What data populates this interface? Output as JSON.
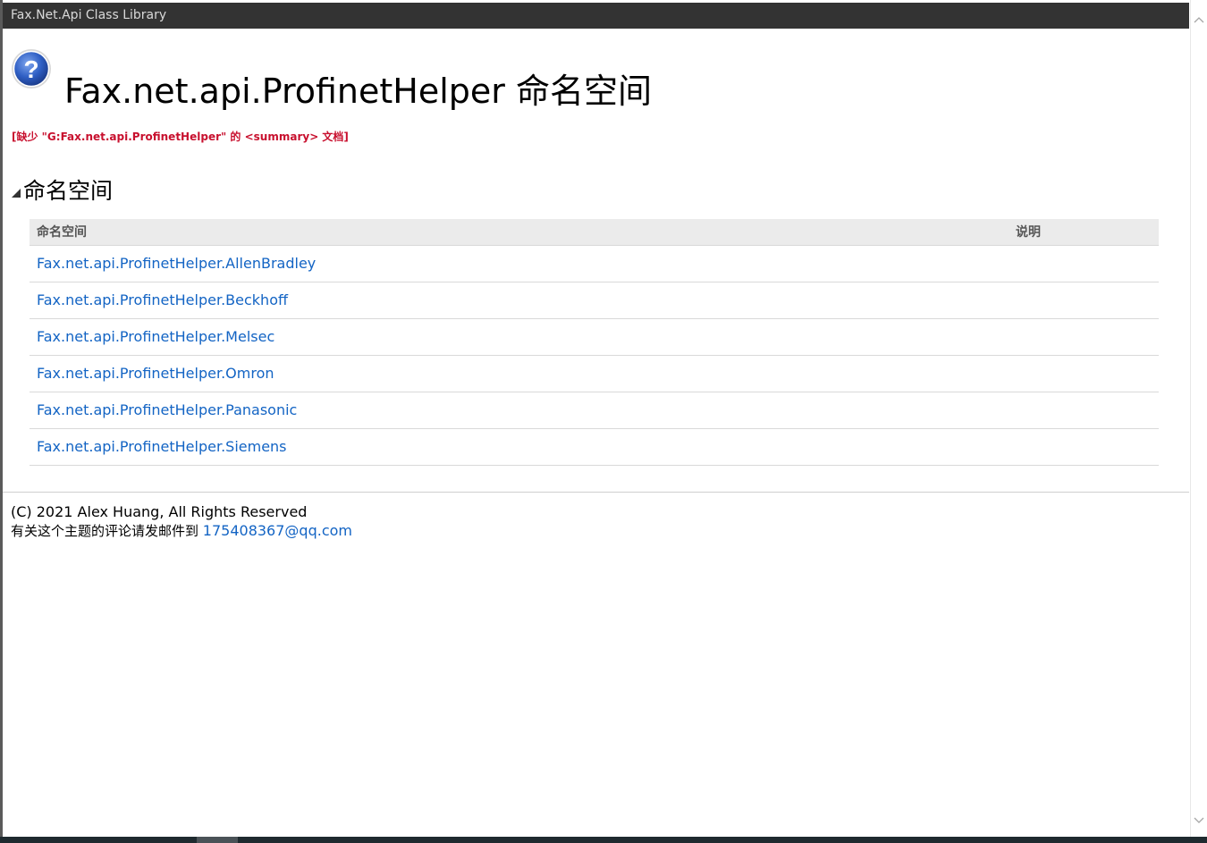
{
  "window": {
    "title": "Fax.Net.Api Class Library"
  },
  "page": {
    "title": "Fax.net.api.ProfinetHelper 命名空间",
    "missing_summary": "[缺少 \"G:Fax.net.api.ProfinetHelper\" 的 <summary> 文档]",
    "header_icon": "help-question-icon"
  },
  "section": {
    "heading": "命名空间",
    "toggle_icon": "collapse-triangle-icon"
  },
  "table": {
    "columns": [
      "命名空间",
      "说明"
    ],
    "rows": [
      {
        "namespace": "Fax.net.api.ProfinetHelper.AllenBradley",
        "description": ""
      },
      {
        "namespace": "Fax.net.api.ProfinetHelper.Beckhoff",
        "description": ""
      },
      {
        "namespace": "Fax.net.api.ProfinetHelper.Melsec",
        "description": ""
      },
      {
        "namespace": "Fax.net.api.ProfinetHelper.Omron",
        "description": ""
      },
      {
        "namespace": "Fax.net.api.ProfinetHelper.Panasonic",
        "description": ""
      },
      {
        "namespace": "Fax.net.api.ProfinetHelper.Siemens",
        "description": ""
      }
    ]
  },
  "footer": {
    "copyright": "(C) 2021 Alex Huang, All Rights Reserved",
    "feedback_text": "有关这个主题的评论请发邮件到",
    "email": "175408367@qq.com"
  },
  "colors": {
    "link": "#1364c4",
    "warning": "#c8102e",
    "title_bar": "#333333"
  }
}
